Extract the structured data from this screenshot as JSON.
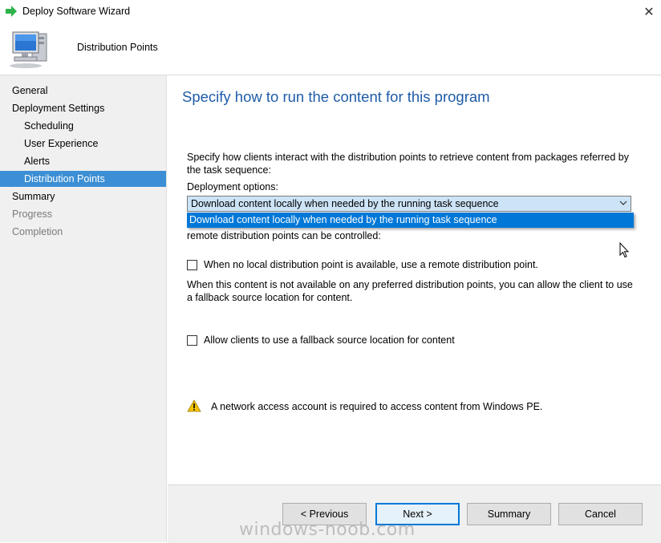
{
  "window": {
    "title": "Deploy Software Wizard",
    "icon": "green-arrow-icon",
    "close_glyph": "✕"
  },
  "header": {
    "title": "Distribution Points",
    "icon": "computer-monitor-icon"
  },
  "sidebar": {
    "items": [
      {
        "label": "General",
        "level": 1,
        "state": "normal"
      },
      {
        "label": "Deployment Settings",
        "level": 1,
        "state": "normal"
      },
      {
        "label": "Scheduling",
        "level": 2,
        "state": "normal"
      },
      {
        "label": "User Experience",
        "level": 2,
        "state": "normal"
      },
      {
        "label": "Alerts",
        "level": 2,
        "state": "normal"
      },
      {
        "label": "Distribution Points",
        "level": 2,
        "state": "selected"
      },
      {
        "label": "Summary",
        "level": 1,
        "state": "normal"
      },
      {
        "label": "Progress",
        "level": 1,
        "state": "disabled"
      },
      {
        "label": "Completion",
        "level": 1,
        "state": "disabled"
      }
    ]
  },
  "main": {
    "title": "Specify how to run the content for this program",
    "intro": "Specify how clients interact with the distribution points to retrieve content from packages referred by the task sequence:",
    "deployment_options_label": "Deployment options:",
    "deployment_options_value": "Download content locally when needed by the running task sequence",
    "dropdown_option": "Download content locally when needed by the running task sequence",
    "remote_text": "remote distribution points can be controlled:",
    "checkbox_remote_label": "When no local distribution point is available, use a remote distribution point.",
    "fallback_desc": "When this content is not available on any preferred distribution points, you can allow the client to use a fallback source location for content.",
    "checkbox_fallback_label": "Allow clients to use a fallback source location for content",
    "warning_text": "A network access account is required to access content from Windows PE."
  },
  "footer": {
    "previous": "< Previous",
    "next": "Next >",
    "summary": "Summary",
    "cancel": "Cancel"
  },
  "watermark": "windows-noob.com",
  "colors": {
    "accent": "#0078d7",
    "title_blue": "#1f5ca8",
    "selected_nav": "#3c8fd4",
    "sidebar_bg": "#f0f0f0"
  }
}
